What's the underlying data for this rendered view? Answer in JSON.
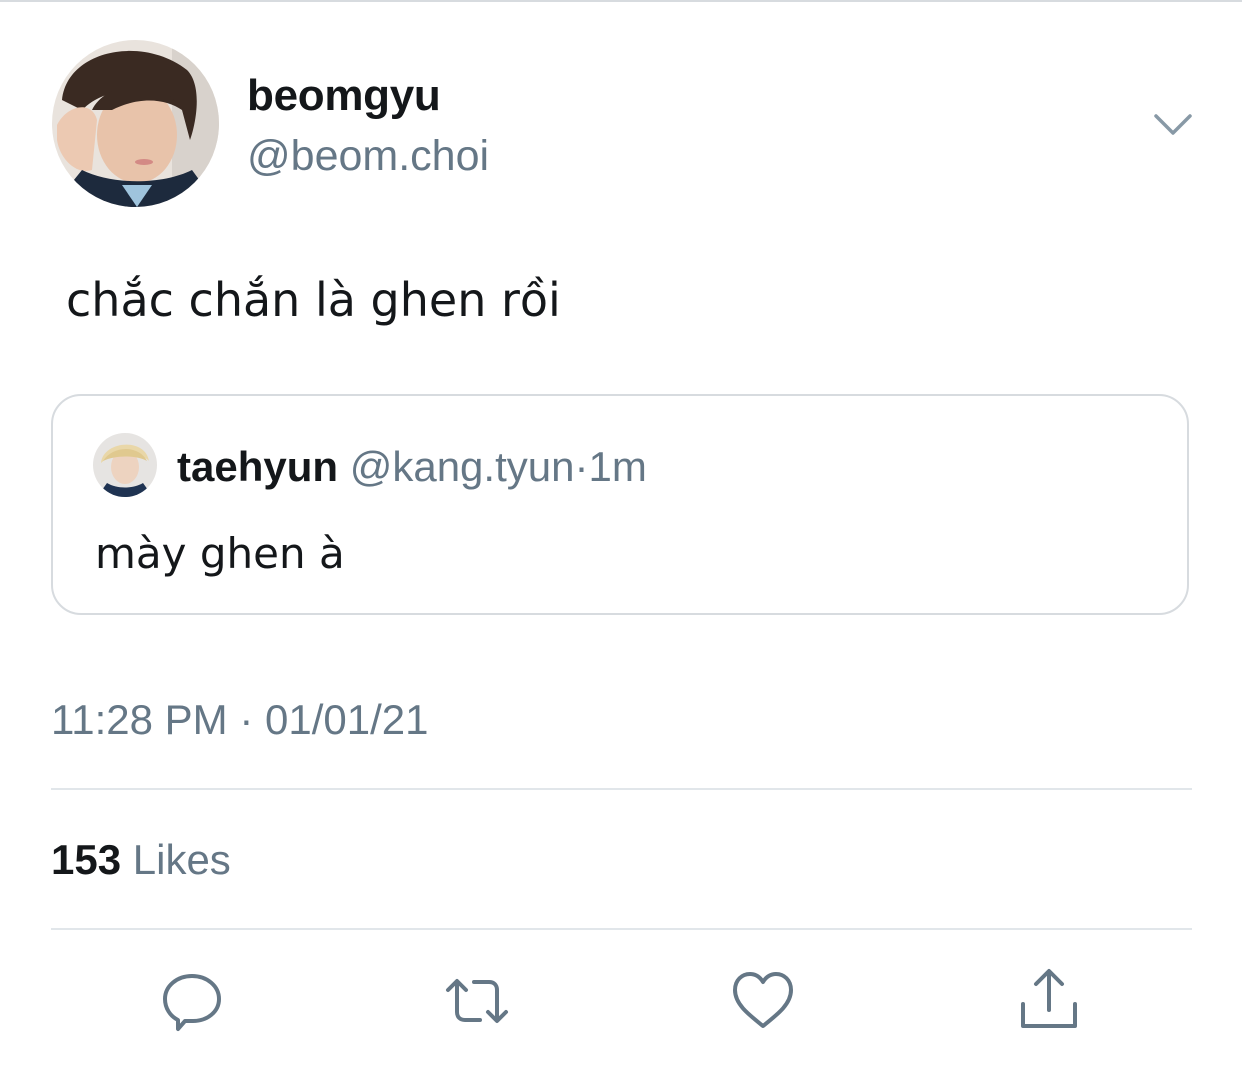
{
  "tweet": {
    "author": {
      "display_name": "beomgyu",
      "handle": "@beom.choi",
      "avatar": "profile-photo"
    },
    "text": "chắc chắn là ghen rồi",
    "quoted_tweet": {
      "author_name": "taehyun",
      "author_handle": "@kang.tyun",
      "separator": "·",
      "time": "1m",
      "text": "mày ghen à"
    },
    "timestamp": "11:28 PM · 01/01/21",
    "likes": {
      "count": "153",
      "label": "Likes"
    }
  },
  "actions": [
    {
      "name": "reply",
      "icon": "speech-bubble-icon"
    },
    {
      "name": "retweet",
      "icon": "retweet-arrows-icon"
    },
    {
      "name": "like",
      "icon": "heart-icon"
    },
    {
      "name": "share",
      "icon": "share-upload-icon"
    }
  ],
  "colors": {
    "text_primary": "#14171a",
    "text_secondary": "#657786",
    "border": "#d7dbdf",
    "background": "#ffffff"
  },
  "icons": {
    "menu": "chevron-down-icon"
  }
}
